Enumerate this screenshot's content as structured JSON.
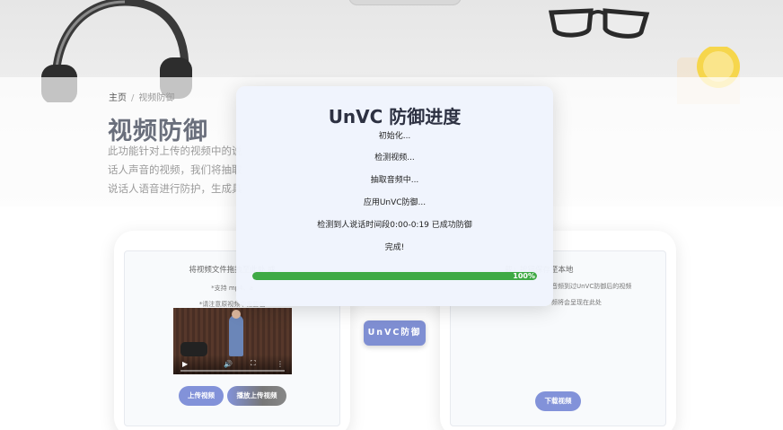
{
  "hero": {
    "breadcrumb_home": "主页",
    "breadcrumb_sep": "/",
    "breadcrumb_current": "视频防御",
    "title": "视频防御",
    "description_lines": [
      "此功能针对上传的视频中的说",
      "话人声音的视频，我们将抽取",
      "说话人语音进行防护，生成具"
    ]
  },
  "upload_card": {
    "hint": "将视频文件拖拽至此处 或",
    "formats": "*支持 mp4、a",
    "note": "*请注意原视频中需要包",
    "upload_button": "上传视频",
    "play_button": "播放上传视频",
    "video_controls": {
      "play": "▶",
      "volume": "🔊",
      "fullscreen": "⛶",
      "more": "⋮"
    }
  },
  "center": {
    "defend_button": "UnVC防御"
  },
  "download_card": {
    "hint": "载」按钮保存至本地",
    "line1": "音频到过UnVC防御后的视频",
    "line2": "频将会呈现在此处",
    "download_button": "下载视频"
  },
  "modal": {
    "title": "UnVC 防御进度",
    "steps": [
      "初始化...",
      "检测视频...",
      "抽取音频中...",
      "应用UnVC防御...",
      "检测到人说话时间段0:00-0:19 已成功防御",
      "完成!"
    ],
    "progress_percent": 100,
    "progress_label": "100%"
  },
  "colors": {
    "accent": "#8292d9",
    "progress": "#3faa45",
    "title": "#6a6f7c"
  }
}
